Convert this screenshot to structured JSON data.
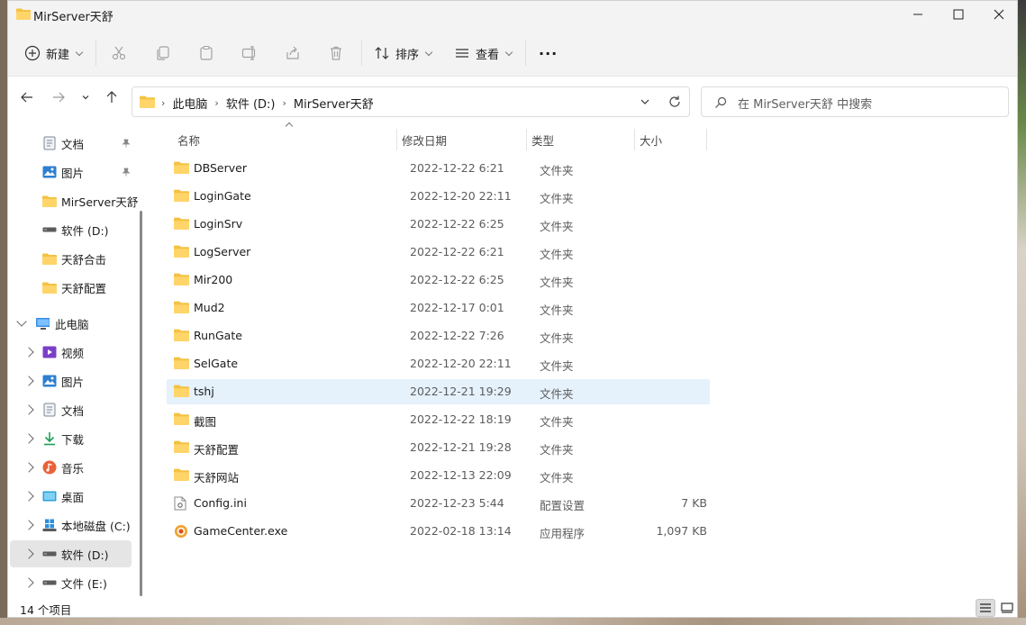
{
  "window": {
    "title": "MirServer天舒"
  },
  "toolbar": {
    "new_label": "新建",
    "sort_label": "排序",
    "view_label": "查看",
    "more_label": "···"
  },
  "address": {
    "crumbs": [
      "此电脑",
      "软件 (D:)",
      "MirServer天舒"
    ],
    "separator": "›"
  },
  "search": {
    "placeholder": "在 MirServer天舒 中搜索"
  },
  "sidebar": {
    "items": [
      {
        "label": "文档",
        "icon": "documents-icon",
        "pinned": true
      },
      {
        "label": "图片",
        "icon": "pictures-icon",
        "pinned": true
      },
      {
        "label": "MirServer天舒",
        "icon": "folder-icon"
      },
      {
        "label": "软件 (D:)",
        "icon": "drive-icon"
      },
      {
        "label": "天舒合击",
        "icon": "folder-icon"
      },
      {
        "label": "天舒配置",
        "icon": "folder-icon"
      },
      {
        "label": "此电脑",
        "icon": "pc-icon",
        "expanded": true
      },
      {
        "label": "视频",
        "icon": "videos-icon"
      },
      {
        "label": "图片",
        "icon": "pictures-icon"
      },
      {
        "label": "文档",
        "icon": "documents-icon"
      },
      {
        "label": "下载",
        "icon": "downloads-icon"
      },
      {
        "label": "音乐",
        "icon": "music-icon"
      },
      {
        "label": "桌面",
        "icon": "desktop-icon"
      },
      {
        "label": "本地磁盘 (C:)",
        "icon": "windows-drive-icon"
      },
      {
        "label": "软件 (D:)",
        "icon": "drive-icon",
        "selected": true
      },
      {
        "label": "文件 (E:)",
        "icon": "drive-icon"
      }
    ]
  },
  "columns": {
    "name": "名称",
    "date": "修改日期",
    "type": "类型",
    "size": "大小"
  },
  "files": [
    {
      "name": "DBServer",
      "date": "2022-12-22 6:21",
      "type": "文件夹",
      "size": "",
      "icon": "folder-icon"
    },
    {
      "name": "LoginGate",
      "date": "2022-12-20 22:11",
      "type": "文件夹",
      "size": "",
      "icon": "folder-icon"
    },
    {
      "name": "LoginSrv",
      "date": "2022-12-22 6:25",
      "type": "文件夹",
      "size": "",
      "icon": "folder-icon"
    },
    {
      "name": "LogServer",
      "date": "2022-12-22 6:21",
      "type": "文件夹",
      "size": "",
      "icon": "folder-icon"
    },
    {
      "name": "Mir200",
      "date": "2022-12-22 6:25",
      "type": "文件夹",
      "size": "",
      "icon": "folder-icon"
    },
    {
      "name": "Mud2",
      "date": "2022-12-17 0:01",
      "type": "文件夹",
      "size": "",
      "icon": "folder-icon"
    },
    {
      "name": "RunGate",
      "date": "2022-12-22 7:26",
      "type": "文件夹",
      "size": "",
      "icon": "folder-icon"
    },
    {
      "name": "SelGate",
      "date": "2022-12-20 22:11",
      "type": "文件夹",
      "size": "",
      "icon": "folder-icon"
    },
    {
      "name": "tshj",
      "date": "2022-12-21 19:29",
      "type": "文件夹",
      "size": "",
      "icon": "folder-icon",
      "hover": true
    },
    {
      "name": "截图",
      "date": "2022-12-22 18:19",
      "type": "文件夹",
      "size": "",
      "icon": "folder-icon"
    },
    {
      "name": "天舒配置",
      "date": "2022-12-21 19:28",
      "type": "文件夹",
      "size": "",
      "icon": "folder-icon"
    },
    {
      "name": "天舒网站",
      "date": "2022-12-13 22:09",
      "type": "文件夹",
      "size": "",
      "icon": "folder-icon"
    },
    {
      "name": "Config.ini",
      "date": "2022-12-23 5:44",
      "type": "配置设置",
      "size": "7 KB",
      "icon": "config-file-icon"
    },
    {
      "name": "GameCenter.exe",
      "date": "2022-02-18 13:14",
      "type": "应用程序",
      "size": "1,097 KB",
      "icon": "app-icon"
    }
  ],
  "status": {
    "count_text": "14 个项目"
  },
  "colors": {
    "folder": "#f4c243",
    "hover_row": "#e5f1fb",
    "selected_nav": "#e5e5e5"
  }
}
